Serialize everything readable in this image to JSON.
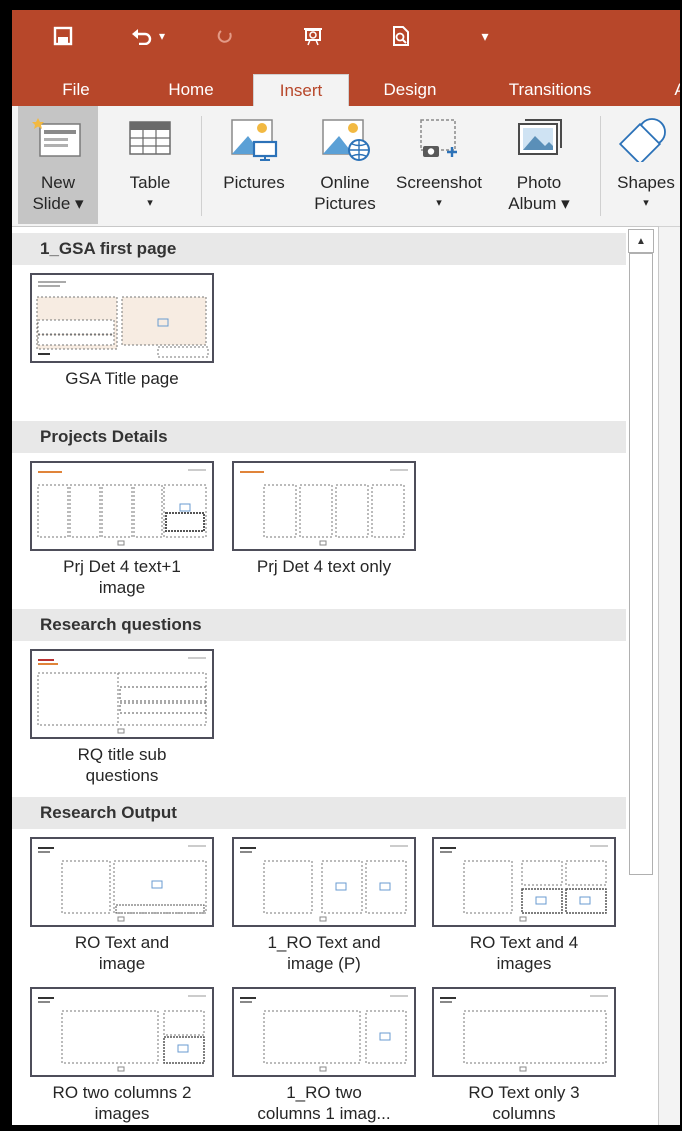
{
  "qat": {
    "save_icon": "save-icon",
    "undo_icon": "undo-icon",
    "undo_caret": "▾",
    "redo_icon": "redo-icon",
    "present_icon": "present-icon",
    "preview_icon": "print-preview-icon",
    "customize": "▾"
  },
  "tabs": [
    {
      "label": "File"
    },
    {
      "label": "Home"
    },
    {
      "label": "Insert"
    },
    {
      "label": "Design"
    },
    {
      "label": "Transitions"
    },
    {
      "label": "A"
    }
  ],
  "ribbon": {
    "new_slide": {
      "line1": "New",
      "line2": "Slide ▾"
    },
    "table": {
      "line1": "Table",
      "line2": "▾"
    },
    "pictures": {
      "line1": "Pictures"
    },
    "online_pictures": {
      "line1": "Online",
      "line2": "Pictures"
    },
    "screenshot": {
      "line1": "Screenshot",
      "line2": "▾"
    },
    "photo_album": {
      "line1": "Photo",
      "line2": "Album ▾"
    },
    "shapes": {
      "line1": "Shapes",
      "line2": "▾"
    }
  },
  "sections": [
    {
      "title": "1_GSA first page"
    },
    {
      "title": "Projects Details"
    },
    {
      "title": "Research questions"
    },
    {
      "title": "Research Output"
    }
  ],
  "layouts": {
    "gsa_title": {
      "line1": "GSA Title page",
      "line2": ""
    },
    "prj_4text_img": {
      "line1": "Prj Det 4 text+1",
      "line2": "image"
    },
    "prj_4text": {
      "line1": "Prj Det 4 text only",
      "line2": ""
    },
    "rq_title": {
      "line1": "RQ title sub",
      "line2": "questions"
    },
    "ro_text_img": {
      "line1": "RO Text and",
      "line2": "image"
    },
    "ro1_text_img": {
      "line1": "1_RO Text and",
      "line2": "image (P)"
    },
    "ro_text_4img": {
      "line1": "RO Text and 4",
      "line2": "images"
    },
    "ro_2col_2img": {
      "line1": "RO two columns 2",
      "line2": "images"
    },
    "ro1_2col_1img": {
      "line1": "1_RO two",
      "line2": "columns 1 imag..."
    },
    "ro_text_3col": {
      "line1": "RO Text only 3",
      "line2": "columns"
    }
  },
  "colors": {
    "accent": "#b7472a",
    "ribbon_bg": "#f3f3f3",
    "section_bg": "#e8e8e8"
  }
}
